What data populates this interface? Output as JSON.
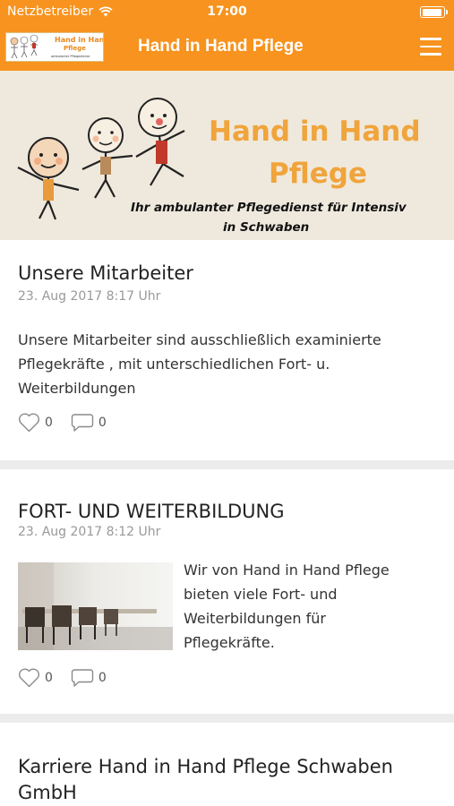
{
  "statusbar": {
    "carrier": "Netzbetreiber",
    "time": "17:00"
  },
  "navbar": {
    "title": "Hand in Hand Pflege",
    "logo_text": "Hand in Hand Pflege"
  },
  "banner": {
    "title_line1": "Hand in Hand",
    "title_line2": "Pflege",
    "subtitle_line1": "Ihr ambulanter Pflegedienst für Intensiv",
    "subtitle_line2": "in Schwaben",
    "accent_color": "#f0a43c"
  },
  "posts": [
    {
      "title": "Unsere Mitarbeiter",
      "date": "23. Aug 2017 8:17 Uhr",
      "text_lines": [
        "Unsere Mitarbeiter sind ausschließlich examinierte",
        "Pflegekräfte , mit unterschiedlichen Fort- u.",
        "Weiterbildungen"
      ],
      "likes": "0",
      "comments": "0"
    },
    {
      "title": "FORT- UND WEITERBILDUNG",
      "date": "23. Aug 2017 8:12 Uhr",
      "text_lines": [
        "Wir von Hand in Hand Pflege",
        "bieten viele Fort- und",
        "Weiterbildungen für",
        "Pflegekräfte."
      ],
      "likes": "0",
      "comments": "0"
    },
    {
      "title_lines": [
        "Karriere Hand in Hand Pflege Schwaben",
        "GmbH"
      ]
    }
  ],
  "colors": {
    "brand_orange": "#f7931e",
    "banner_bg": "#efe9dd"
  },
  "icons": [
    "wifi-icon",
    "battery-icon",
    "menu-icon",
    "heart-icon",
    "comment-icon"
  ]
}
